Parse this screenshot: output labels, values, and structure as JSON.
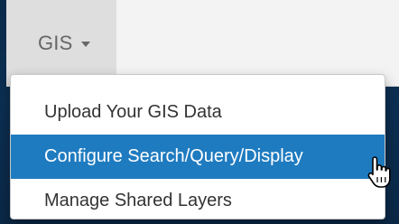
{
  "nav": {
    "tab_label": "GIS",
    "tab_icon": "caret-down-icon"
  },
  "menu": {
    "items": [
      {
        "label": "Upload Your GIS Data",
        "active": false
      },
      {
        "label": "Configure Search/Query/Display",
        "active": true
      },
      {
        "label": "Manage Shared Layers",
        "active": false
      }
    ]
  },
  "colors": {
    "background": "#0c2f52",
    "navbar": "#f3f3f3",
    "tab_active_bg": "#dedede",
    "highlight": "#1f7bc0"
  },
  "cursor_icon": "hand-pointer-icon"
}
